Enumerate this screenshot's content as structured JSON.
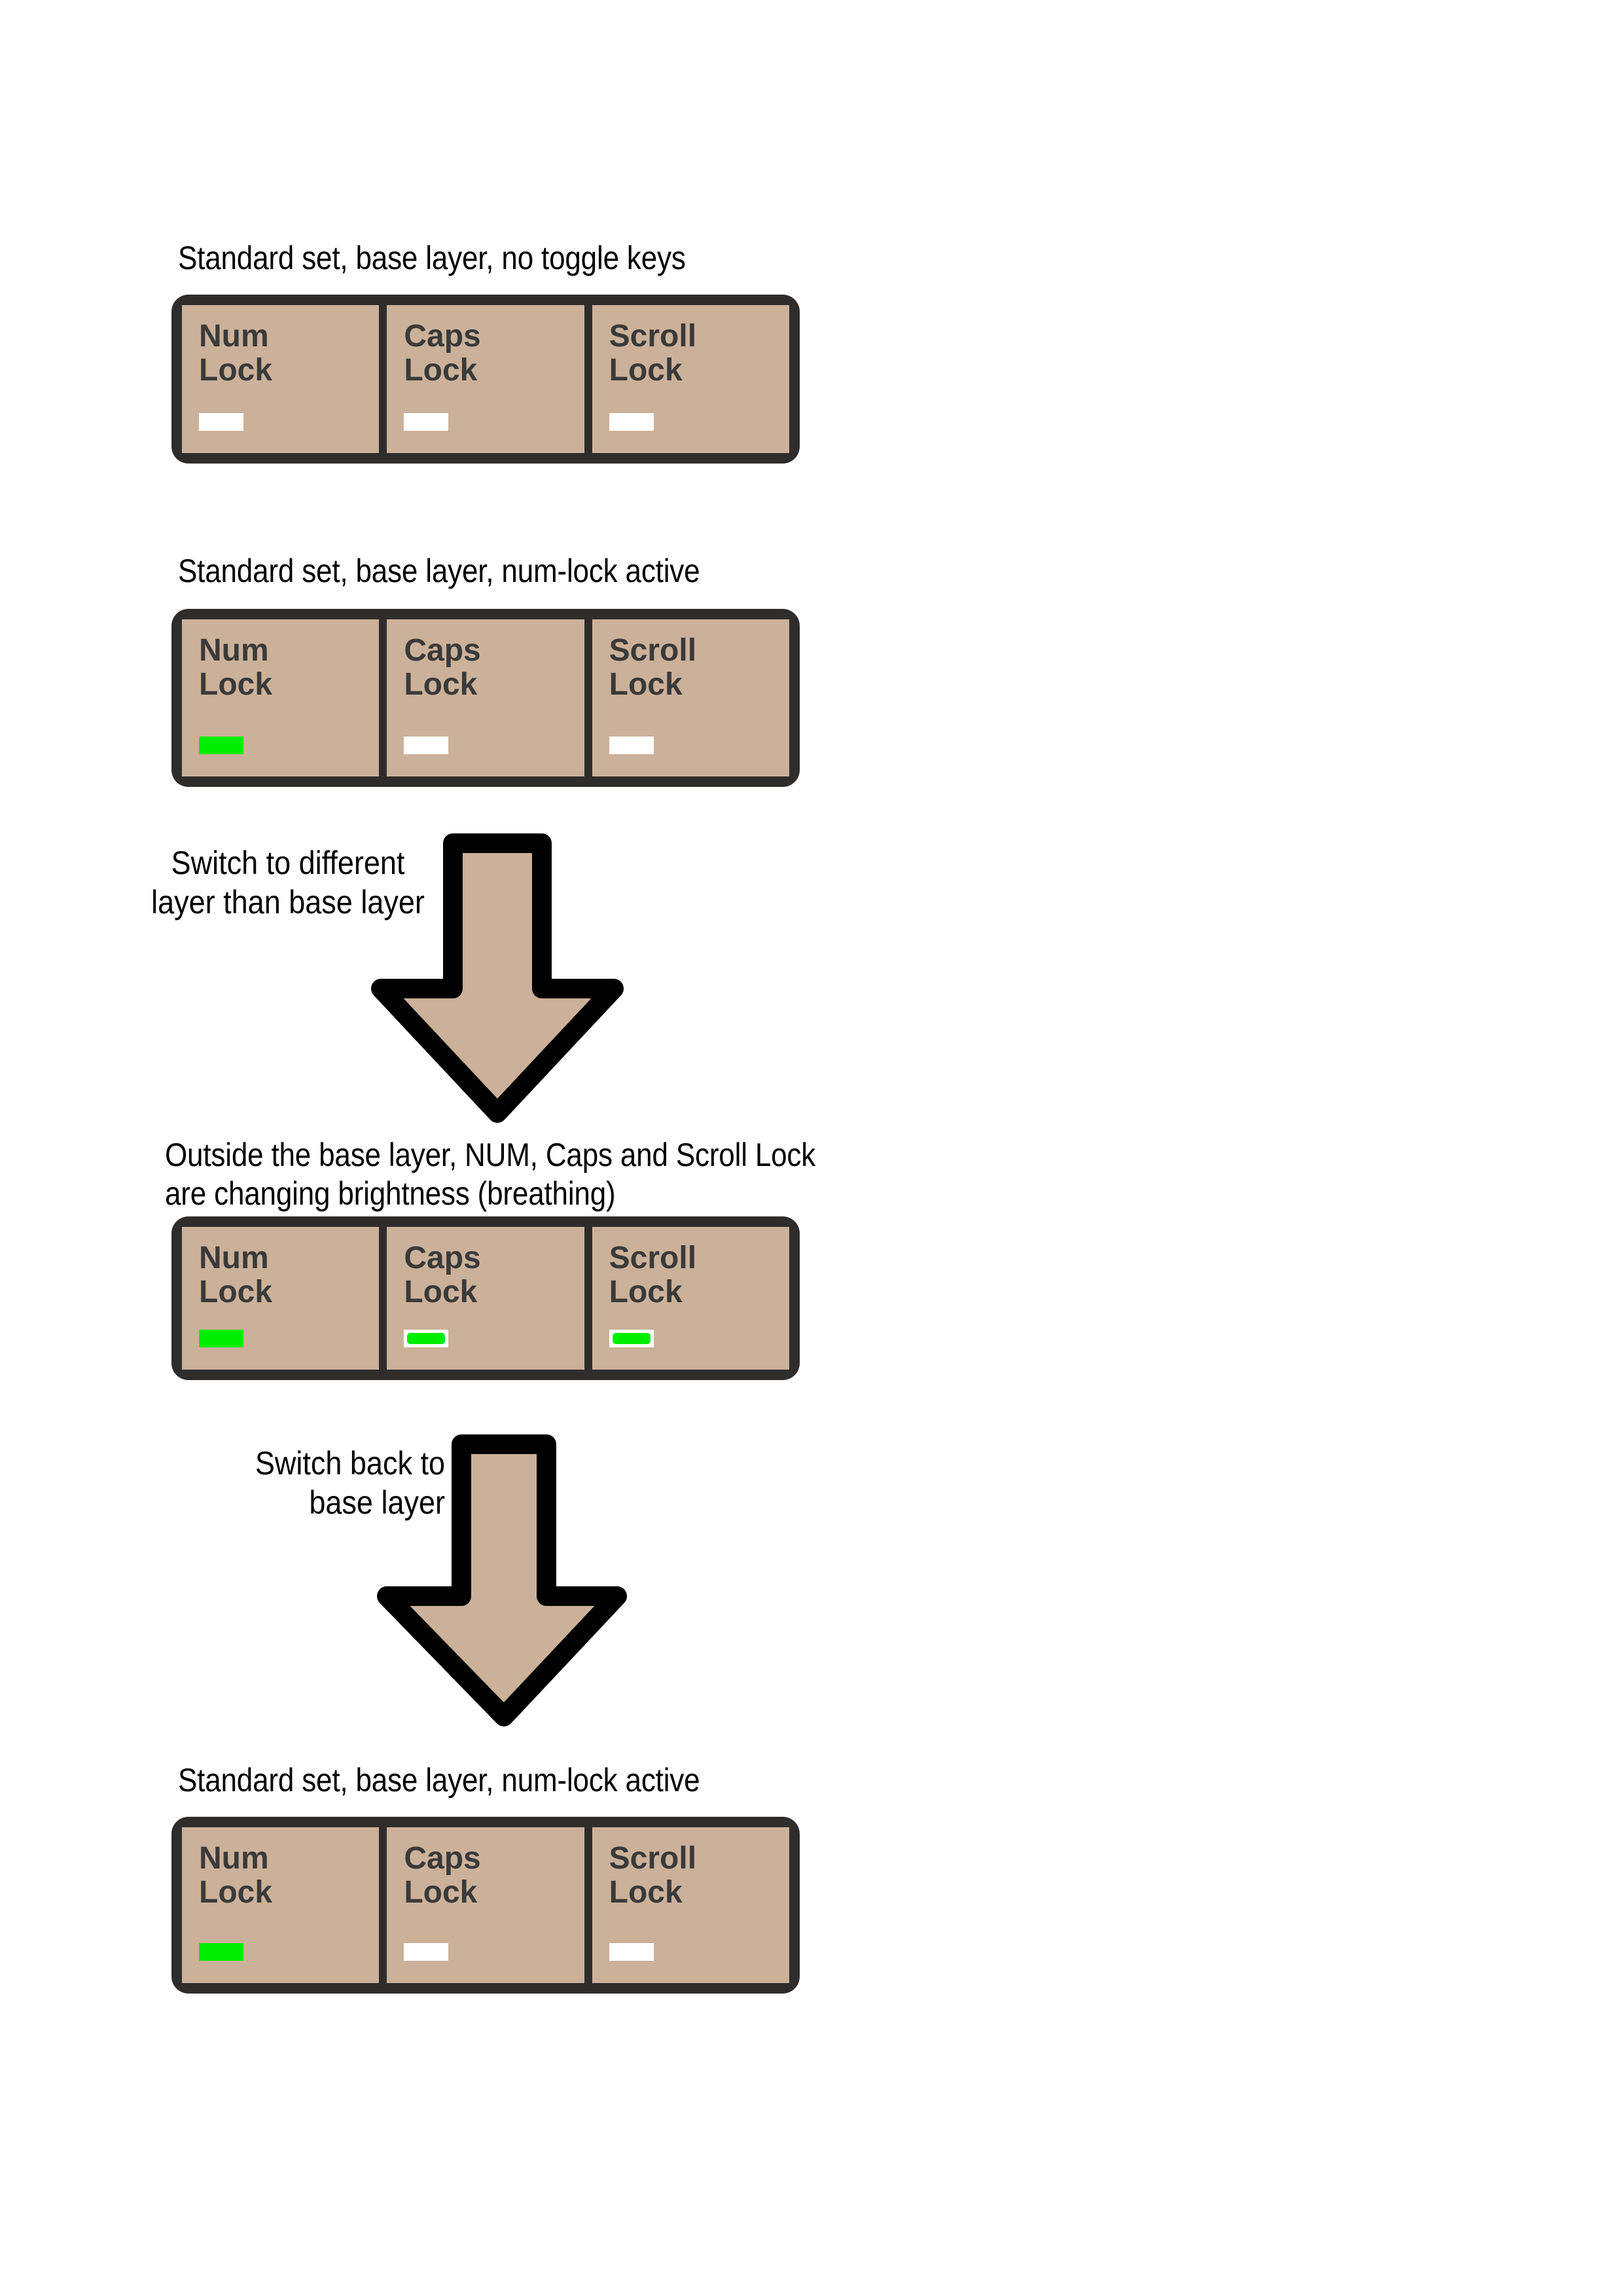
{
  "page": {
    "background": "#ffffff",
    "bezel_color": "#2e2d2c",
    "keycap_color": "#cbb199",
    "led_on_color": "#00ee00",
    "led_off_color": "#ffffff",
    "label_color": "#3a3a3a",
    "text_color": "#000000",
    "arrow_fill": "#cbb199",
    "arrow_stroke": "#000000"
  },
  "sections": [
    {
      "id": "section-1",
      "caption": "Standard set, base layer, no toggle keys",
      "keys": [
        {
          "label_line1": "Num",
          "label_line2": "Lock",
          "led_state": "off"
        },
        {
          "label_line1": "Caps",
          "label_line2": "Lock",
          "led_state": "off"
        },
        {
          "label_line1": "Scroll",
          "label_line2": "Lock",
          "led_state": "off"
        }
      ]
    },
    {
      "id": "section-2",
      "caption": "Standard set, base layer, num-lock active",
      "keys": [
        {
          "label_line1": "Num",
          "label_line2": "Lock",
          "led_state": "on"
        },
        {
          "label_line1": "Caps",
          "label_line2": "Lock",
          "led_state": "off"
        },
        {
          "label_line1": "Scroll",
          "label_line2": "Lock",
          "led_state": "off"
        }
      ]
    },
    {
      "id": "section-3",
      "caption": "Outside the base layer, NUM, Caps and Scroll Lock\nare changing brightness (breathing)",
      "keys": [
        {
          "label_line1": "Num",
          "label_line2": "Lock",
          "led_state": "on"
        },
        {
          "label_line1": "Caps",
          "label_line2": "Lock",
          "led_state": "breathing"
        },
        {
          "label_line1": "Scroll",
          "label_line2": "Lock",
          "led_state": "breathing"
        }
      ]
    },
    {
      "id": "section-4",
      "caption": "Standard set, base layer, num-lock active",
      "keys": [
        {
          "label_line1": "Num",
          "label_line2": "Lock",
          "led_state": "on"
        },
        {
          "label_line1": "Caps",
          "label_line2": "Lock",
          "led_state": "off"
        },
        {
          "label_line1": "Scroll",
          "label_line2": "Lock",
          "led_state": "off"
        }
      ]
    }
  ],
  "arrows": [
    {
      "id": "arrow-1",
      "label_line1": "Switch to different",
      "label_line2": "layer than base layer",
      "direction": "down"
    },
    {
      "id": "arrow-2",
      "label_line1": "Switch back to",
      "label_line2": "base layer",
      "direction": "down"
    }
  ]
}
